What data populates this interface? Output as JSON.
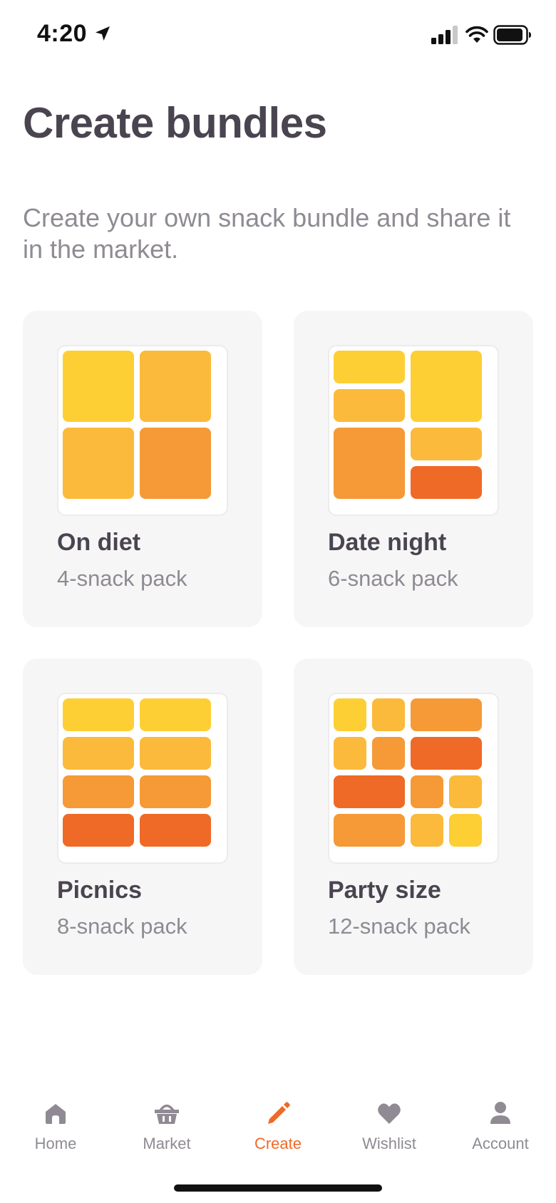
{
  "status_bar": {
    "time": "4:20",
    "location_icon": "location-arrow-icon",
    "signal_icon": "cellular-signal-icon",
    "wifi_icon": "wifi-icon",
    "battery_icon": "battery-icon"
  },
  "header": {
    "title": "Create bundles",
    "subtitle": "Create your own snack bundle and share it in the market."
  },
  "bundles": [
    {
      "name": "On diet",
      "pack": "4-snack pack"
    },
    {
      "name": "Date night",
      "pack": "6-snack pack"
    },
    {
      "name": "Picnics",
      "pack": "8-snack pack"
    },
    {
      "name": "Party size",
      "pack": "12-snack pack"
    }
  ],
  "tab_bar": {
    "active": "Create",
    "accent_color": "#ef6a26",
    "tabs": [
      {
        "label": "Home",
        "icon": "home-icon"
      },
      {
        "label": "Market",
        "icon": "basket-icon"
      },
      {
        "label": "Create",
        "icon": "pencil-icon"
      },
      {
        "label": "Wishlist",
        "icon": "heart-icon"
      },
      {
        "label": "Account",
        "icon": "user-icon"
      }
    ]
  },
  "colors": {
    "yellow": "#fdcf35",
    "light_orange": "#fbba3b",
    "orange": "#f59a36",
    "dark_orange": "#ef6a26",
    "card_background": "#f6f6f6"
  }
}
